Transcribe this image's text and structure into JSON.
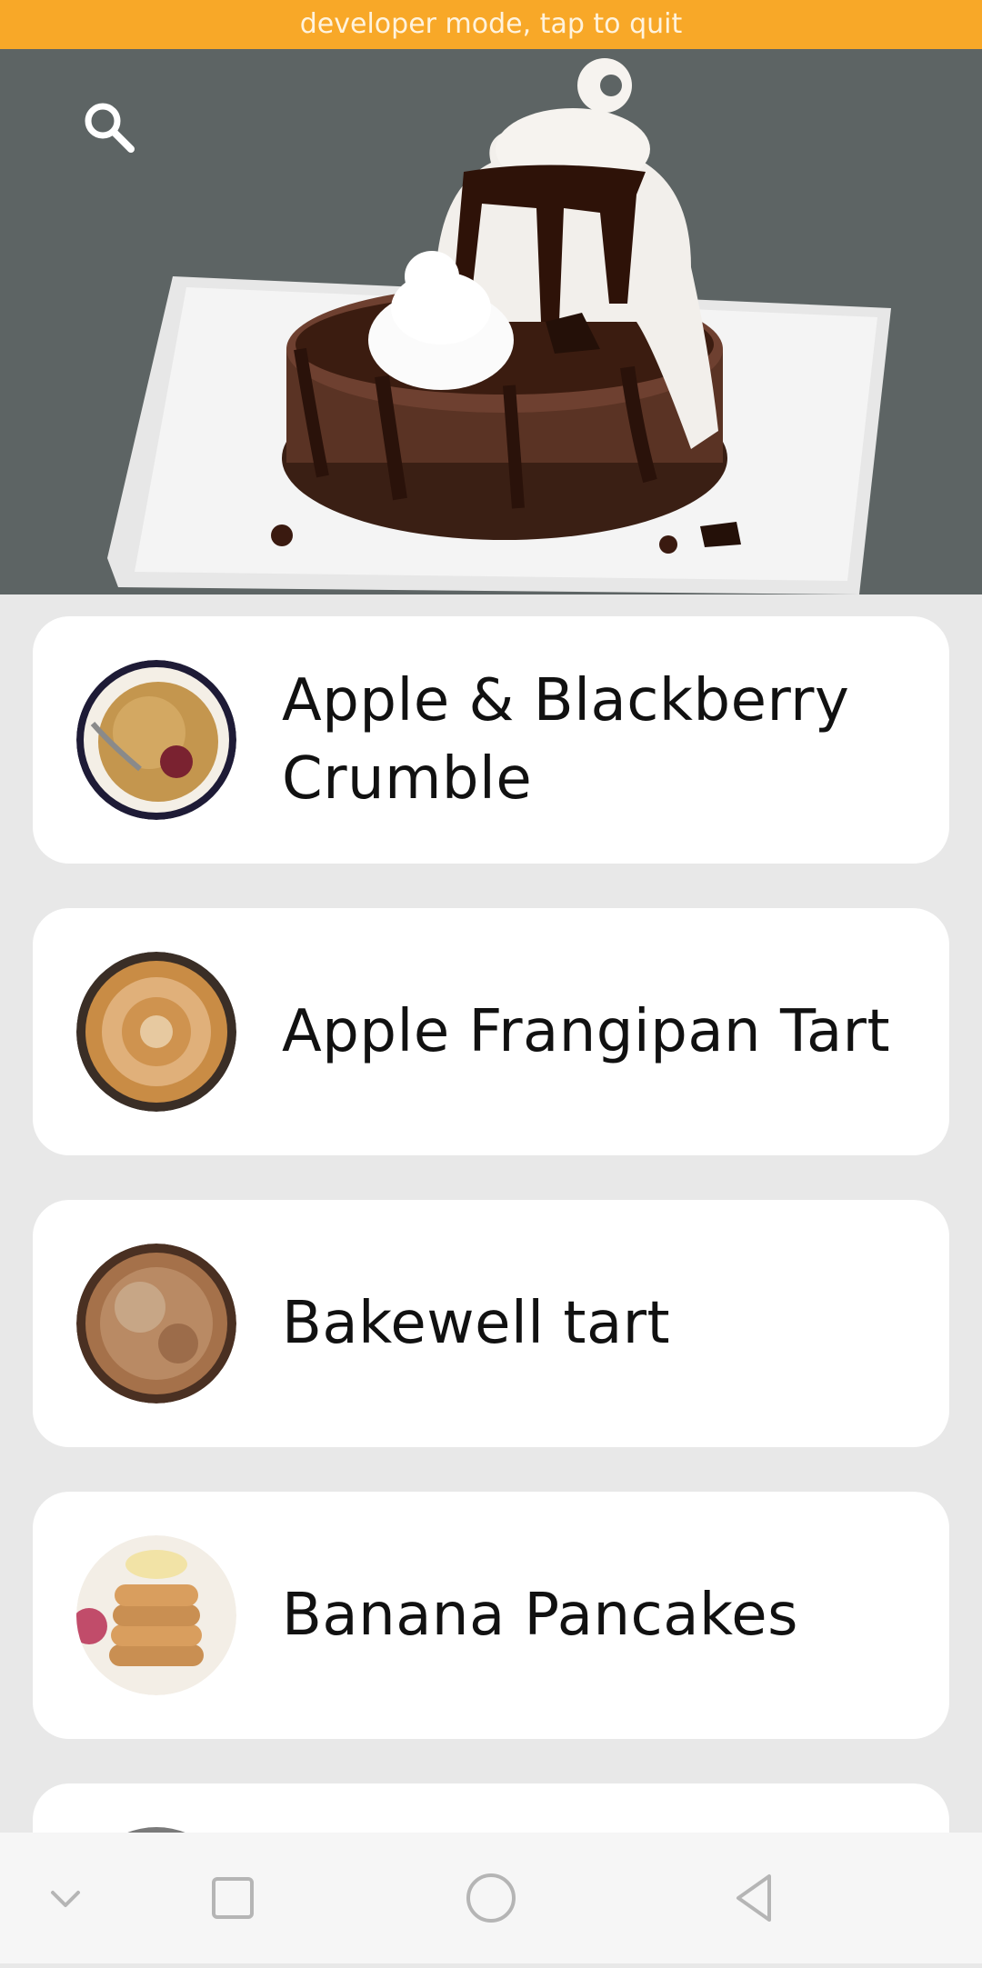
{
  "status_banner": {
    "text": "developer mode, tap to quit"
  },
  "hero": {
    "image": "chocolate-lava-cake-with-ice-cream"
  },
  "search": {
    "icon": "search-icon"
  },
  "recipes": [
    {
      "title": "Apple & Blackberry Crumble",
      "thumb": "crumble"
    },
    {
      "title": "Apple Frangipan Tart",
      "thumb": "apple-tart"
    },
    {
      "title": "Bakewell tart",
      "thumb": "bakewell-tart"
    },
    {
      "title": "Banana Pancakes",
      "thumb": "banana-pancakes"
    }
  ],
  "navbar": {
    "items": [
      "collapse-icon",
      "recents-icon",
      "home-icon",
      "back-icon"
    ]
  },
  "colors": {
    "banner": "#f8a828",
    "hero_background": "#5d6464",
    "list_background": "#e8e8e8",
    "card": "#ffffff"
  }
}
